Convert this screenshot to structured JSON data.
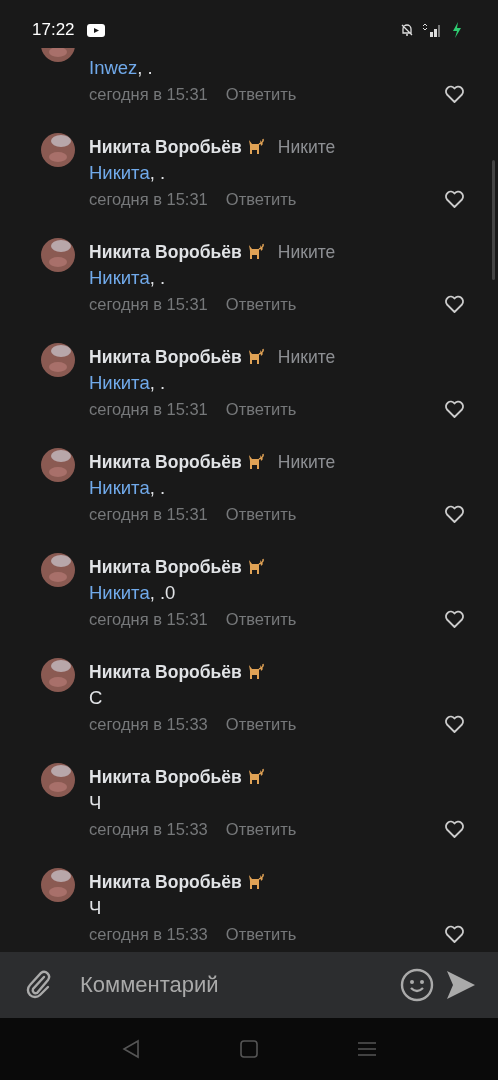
{
  "status_bar": {
    "time": "17:22"
  },
  "comments": [
    {
      "mention": "Inwez",
      "text": ", .",
      "time": "сегодня в 15:31",
      "reply": "Ответить"
    },
    {
      "author": "Никита Воробьёв",
      "reply_to": "Никите",
      "mention": "Никита",
      "text": ", .",
      "time": "сегодня в 15:31",
      "reply": "Ответить"
    },
    {
      "author": "Никита Воробьёв",
      "reply_to": "Никите",
      "mention": "Никита",
      "text": ", .",
      "time": "сегодня в 15:31",
      "reply": "Ответить"
    },
    {
      "author": "Никита Воробьёв",
      "reply_to": "Никите",
      "mention": "Никита",
      "text": ", .",
      "time": "сегодня в 15:31",
      "reply": "Ответить"
    },
    {
      "author": "Никита Воробьёв",
      "reply_to": "Никите",
      "mention": "Никита",
      "text": ", .",
      "time": "сегодня в 15:31",
      "reply": "Ответить"
    },
    {
      "author": "Никита Воробьёв",
      "mention": "Никита",
      "text": ", .0",
      "time": "сегодня в 15:31",
      "reply": "Ответить"
    },
    {
      "author": "Никита Воробьёв",
      "text": "С",
      "time": "сегодня в 15:33",
      "reply": "Ответить"
    },
    {
      "author": "Никита Воробьёв",
      "text": "Ч",
      "time": "сегодня в 15:33",
      "reply": "Ответить"
    },
    {
      "author": "Никита Воробьёв",
      "text": "Ч",
      "time": "сегодня в 15:33",
      "reply": "Ответить"
    }
  ],
  "composer": {
    "placeholder": "Комментарий"
  }
}
